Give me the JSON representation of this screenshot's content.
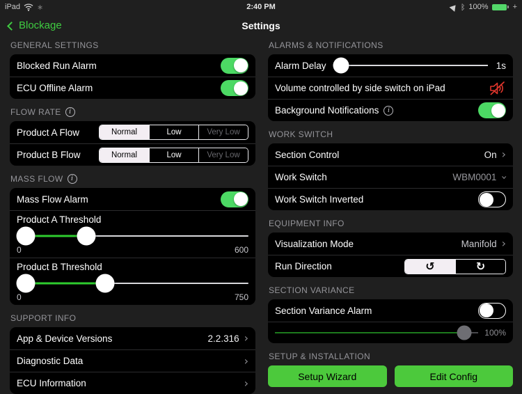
{
  "status_bar": {
    "device_label": "iPad",
    "time": "2:40 PM",
    "battery_percent": "100%",
    "charging_glyph": "+",
    "bluetooth_glyph": "ᛒ",
    "spinner_glyph": "∗"
  },
  "nav": {
    "back_label": "Blockage",
    "title": "Settings"
  },
  "icons": {
    "info_glyph": "i",
    "chevron_right": "›",
    "chevron_down": "›",
    "run_ccw_glyph": "↺",
    "run_cw_glyph": "↻"
  },
  "left_column": {
    "general_settings": {
      "header": "GENERAL SETTINGS",
      "blocked_run_alarm": {
        "label": "Blocked Run Alarm",
        "state": "on"
      },
      "ecu_offline_alarm": {
        "label": "ECU Offline Alarm",
        "state": "on"
      }
    },
    "flow_rate": {
      "header": "FLOW RATE",
      "options": [
        "Normal",
        "Low",
        "Very Low"
      ],
      "product_a": {
        "label": "Product A Flow",
        "selected": "Normal"
      },
      "product_b": {
        "label": "Product B Flow",
        "selected": "Normal"
      }
    },
    "mass_flow": {
      "header": "MASS FLOW",
      "alarm": {
        "label": "Mass Flow Alarm",
        "state": "on"
      },
      "product_a_threshold": {
        "label": "Product A Threshold",
        "min_label": "0",
        "max_label": "600"
      },
      "product_b_threshold": {
        "label": "Product B Threshold",
        "min_label": "0",
        "max_label": "750"
      }
    },
    "support_info": {
      "header": "SUPPORT INFO",
      "app_device_versions": {
        "label": "App & Device Versions",
        "value": "2.2.316"
      },
      "diagnostic_data": {
        "label": "Diagnostic Data"
      },
      "ecu_information": {
        "label": "ECU Information"
      }
    }
  },
  "right_column": {
    "alarms_notifications": {
      "header": "ALARMS & NOTIFICATIONS",
      "alarm_delay": {
        "label": "Alarm Delay",
        "value": "1s"
      },
      "volume_note": {
        "label": "Volume controlled by side switch on iPad",
        "muted": true
      },
      "background_notifications": {
        "label": "Background Notifications",
        "state": "on"
      }
    },
    "work_switch": {
      "header": "WORK SWITCH",
      "section_control": {
        "label": "Section Control",
        "value": "On"
      },
      "work_switch": {
        "label": "Work Switch",
        "value": "WBM0001"
      },
      "work_switch_inverted": {
        "label": "Work Switch Inverted",
        "state": "off"
      }
    },
    "equipment_info": {
      "header": "EQUIPMENT INFO",
      "visualization_mode": {
        "label": "Visualization Mode",
        "value": "Manifold"
      },
      "run_direction": {
        "label": "Run Direction",
        "selected": "counterclockwise"
      }
    },
    "section_variance": {
      "header": "SECTION VARIANCE",
      "alarm": {
        "label": "Section Variance Alarm",
        "state": "off"
      },
      "slider_value": "100%"
    },
    "setup_installation": {
      "header": "SETUP & INSTALLATION",
      "setup_wizard_label": "Setup Wizard",
      "edit_config_label": "Edit Config"
    }
  },
  "colors": {
    "accent_green": "#3fcc41",
    "toggle_green": "#4cd964",
    "button_green": "#4cc93c",
    "mute_red": "#e0362c",
    "card_black": "#000000",
    "page_background": "#1f1f1f"
  }
}
